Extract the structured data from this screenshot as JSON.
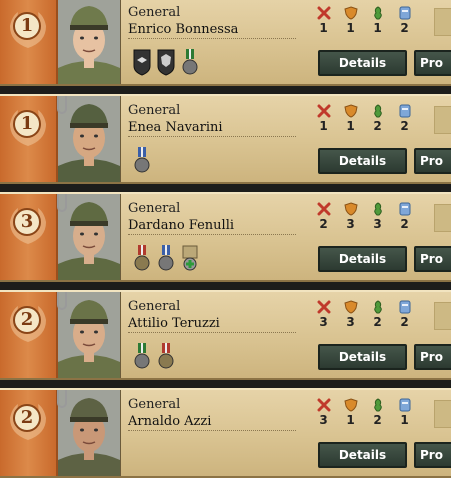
{
  "ui": {
    "details_label": "Details",
    "promote_label": "Pro"
  },
  "colors": {
    "rank_column": "#d97c3c",
    "button": "#2c3a31",
    "panel": "#d9c391"
  },
  "stat_icons": [
    "attack-icon",
    "defense-icon",
    "planning-icon",
    "logistics-icon"
  ],
  "generals": [
    {
      "rank": "1",
      "title": "General",
      "name": "Enrico Bonnessa",
      "stats": [
        "1",
        "1",
        "1",
        "2"
      ],
      "traits": [
        "handshake-trait-icon",
        "shield-trait-icon",
        "green-medal-trait-icon"
      ],
      "hat": "#6f7a4c",
      "skin": "#e7c2a2"
    },
    {
      "rank": "1",
      "title": "General",
      "name": "Enea Navarini",
      "stats": [
        "1",
        "1",
        "2",
        "2"
      ],
      "traits": [
        "blue-medal-trait-icon"
      ],
      "hat": "#556040",
      "skin": "#d6a882"
    },
    {
      "rank": "3",
      "title": "General",
      "name": "Dardano Fenulli",
      "stats": [
        "2",
        "3",
        "3",
        "2"
      ],
      "traits": [
        "red-medal-trait-icon",
        "blue-medal-trait-icon",
        "medic-trait-icon"
      ],
      "hat": "#5f6a42",
      "skin": "#d7ae8c"
    },
    {
      "rank": "2",
      "title": "General",
      "name": "Attilio Teruzzi",
      "stats": [
        "3",
        "3",
        "2",
        "2"
      ],
      "traits": [
        "green-medal-trait-icon",
        "red-medal-trait-icon"
      ],
      "hat": "#6a7348",
      "skin": "#d9ad8a"
    },
    {
      "rank": "2",
      "title": "General",
      "name": "Arnaldo Azzi",
      "stats": [
        "3",
        "1",
        "2",
        "1"
      ],
      "traits": [],
      "hat": "#5d6244",
      "skin": "#c99877"
    }
  ]
}
